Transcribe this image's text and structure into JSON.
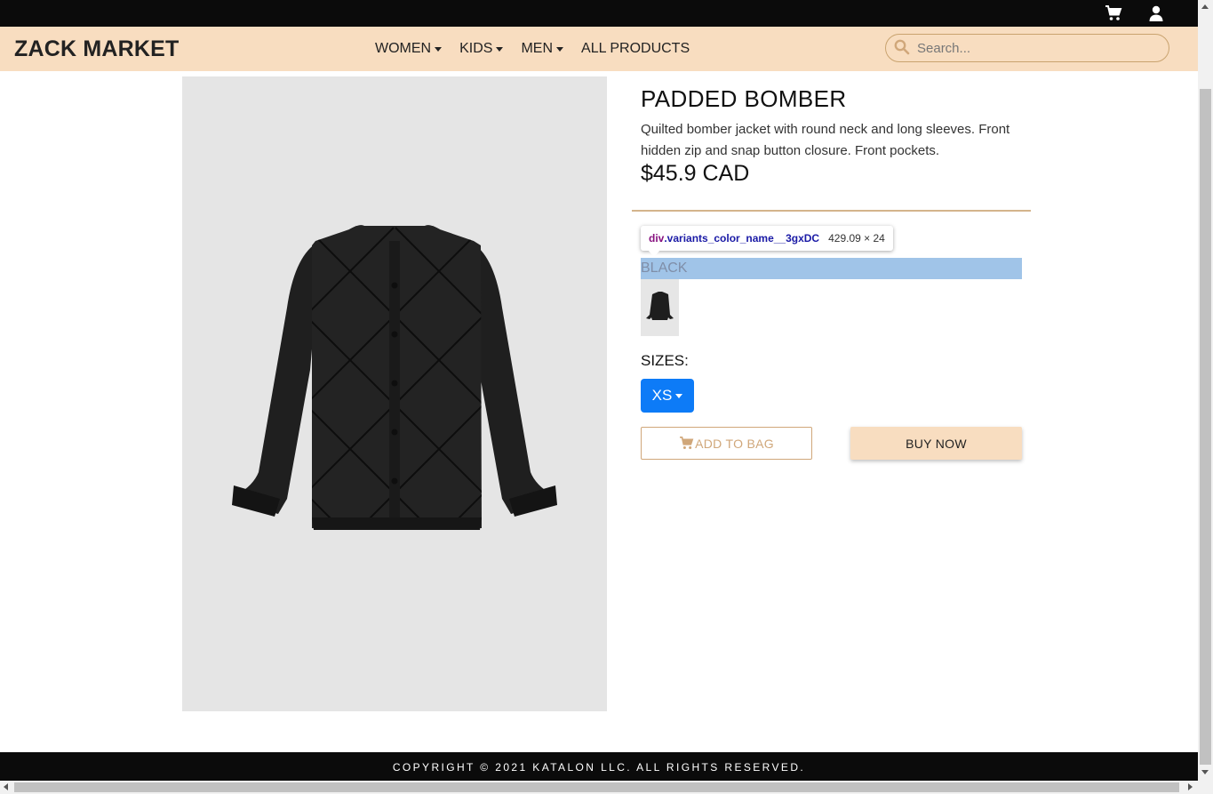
{
  "app": {
    "brand": "ZACK MARKET"
  },
  "topbar": {
    "icons": [
      "cart-icon",
      "user-icon"
    ]
  },
  "nav": {
    "items": [
      {
        "label": "WOMEN",
        "has_dropdown": true
      },
      {
        "label": "KIDS",
        "has_dropdown": true
      },
      {
        "label": "MEN",
        "has_dropdown": true
      },
      {
        "label": "ALL PRODUCTS",
        "has_dropdown": false
      }
    ],
    "search": {
      "placeholder": "Search...",
      "value": ""
    }
  },
  "product": {
    "title": "PADDED BOMBER",
    "description": "Quilted bomber jacket with round neck and long sleeves. Front hidden zip and snap button closure. Front pockets.",
    "price": "$45.9 CAD",
    "color_name": "BLACK",
    "sizes_label": "SIZES:",
    "selected_size": "XS",
    "add_to_bag_label": "ADD TO BAG",
    "buy_now_label": "BUY NOW"
  },
  "inspector_tooltip": {
    "tag": "div",
    "class": ".variants_color_name__3gxDC",
    "dimensions": "429.09 × 24"
  },
  "footer": {
    "copyright": "COPYRIGHT © 2021 KATALON LLC. ALL RIGHTS RESERVED."
  },
  "colors": {
    "accent": "#f8ddc0",
    "accent_border": "#d0a77a",
    "size_button": "#0d7bf7",
    "bars": "#0b0b0b",
    "highlight": "#a0c4e8"
  }
}
